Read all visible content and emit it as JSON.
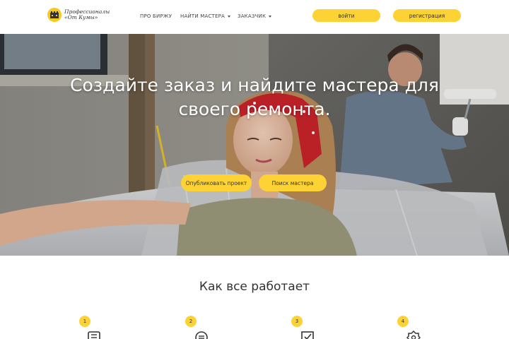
{
  "brand": {
    "logo_line1": "Профессионалы",
    "logo_line2": "«От Кумы»",
    "accent_color": "#fdd235"
  },
  "nav": {
    "items": [
      {
        "label": "ПРО БИРЖУ",
        "has_dropdown": false
      },
      {
        "label": "НАЙТИ МАСТЕРА",
        "has_dropdown": true
      },
      {
        "label": "ЗАКАЗЧИК",
        "has_dropdown": true
      }
    ],
    "login_label": "войти",
    "register_label": "регистрация"
  },
  "hero": {
    "title": "Создайте заказ и найдите мастера для своего ремонта.",
    "publish_label": "Опубликовать проект",
    "find_label": "Поиск мастера"
  },
  "how_it_works": {
    "title": "Как все работает",
    "steps": [
      {
        "number": "1",
        "icon": "document-icon"
      },
      {
        "number": "2",
        "icon": "list-icon"
      },
      {
        "number": "3",
        "icon": "check-icon"
      },
      {
        "number": "4",
        "icon": "badge-icon"
      }
    ]
  }
}
